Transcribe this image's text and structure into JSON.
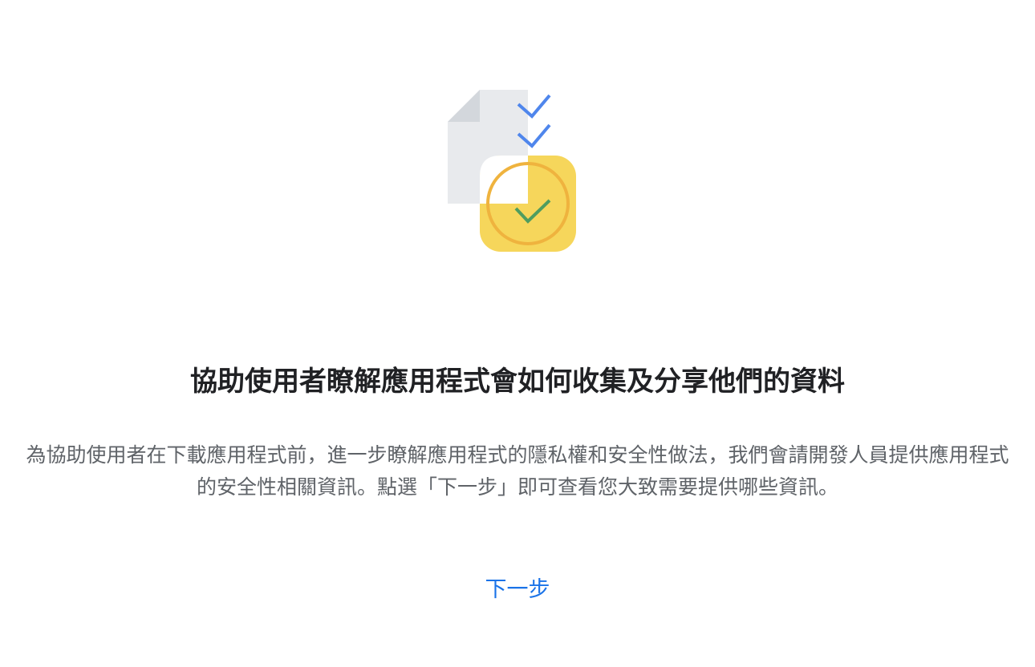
{
  "dialog": {
    "illustration_icon": "document-checklist-checkmark-icon",
    "title": "協助使用者瞭解應用程式會如何收集及分享他們的資料",
    "description": "為協助使用者在下載應用程式前，進一步瞭解應用程式的隱私權和安全性做法，我們會請開發人員提供應用程式的安全性相關資訊。點選「下一步」即可查看您大致需要提供哪些資訊。",
    "next_button_label": "下一步"
  },
  "colors": {
    "title": "#202124",
    "body_text": "#5f6368",
    "link_blue": "#1a73e8",
    "check_blue": "#4f86ec",
    "check_green": "#4f9d5f",
    "badge_yellow": "#f6d65b",
    "badge_ring": "#efb33e",
    "document_gray": "#e8eaed",
    "fold_gray": "#d3d7dc"
  }
}
